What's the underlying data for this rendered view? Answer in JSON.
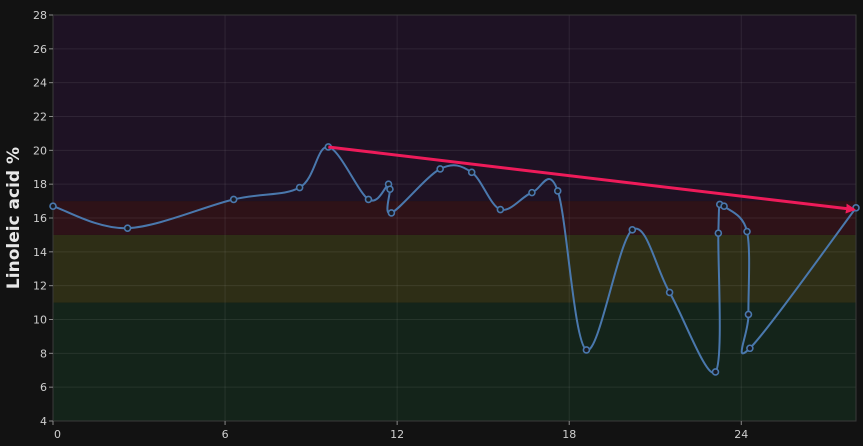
{
  "chart_data": {
    "type": "line",
    "title": "",
    "xlabel": "",
    "ylabel": "Linoleic acid %",
    "xlim": [
      0,
      28
    ],
    "ylim": [
      4,
      28
    ],
    "x_ticks": [
      0,
      6,
      12,
      18,
      24
    ],
    "y_ticks": [
      4,
      6,
      8,
      10,
      12,
      14,
      16,
      18,
      20,
      22,
      24,
      26,
      28
    ],
    "grid": true,
    "legend": "none",
    "bands": [
      {
        "from": 4,
        "to": 11,
        "color": "#14241a"
      },
      {
        "from": 11,
        "to": 15,
        "color": "#2e2e16"
      },
      {
        "from": 15,
        "to": 17,
        "color": "#2e1218"
      },
      {
        "from": 17,
        "to": 28,
        "color": "#1e1224"
      }
    ],
    "series": [
      {
        "color": "#4a78ad",
        "x": [
          0,
          2.6,
          6.3,
          8.6,
          9.6,
          11.0,
          11.7,
          11.75,
          11.8,
          13.5,
          14.6,
          15.6,
          16.7,
          17.6,
          18.6,
          20.2,
          21.5,
          23.1,
          23.2,
          23.25,
          23.4,
          24.2,
          24.25,
          24.3,
          28.0
        ],
        "y": [
          16.7,
          15.4,
          17.1,
          17.8,
          20.2,
          17.1,
          18.0,
          17.7,
          16.3,
          18.9,
          18.7,
          16.5,
          17.5,
          17.6,
          8.2,
          15.3,
          11.6,
          6.9,
          15.1,
          16.8,
          16.7,
          15.2,
          10.3,
          8.3,
          16.6
        ]
      }
    ],
    "trend_arrow": {
      "color": "#ee1b5a",
      "from": {
        "x": 9.6,
        "y": 20.2
      },
      "to": {
        "x": 28.0,
        "y": 16.5
      }
    }
  }
}
